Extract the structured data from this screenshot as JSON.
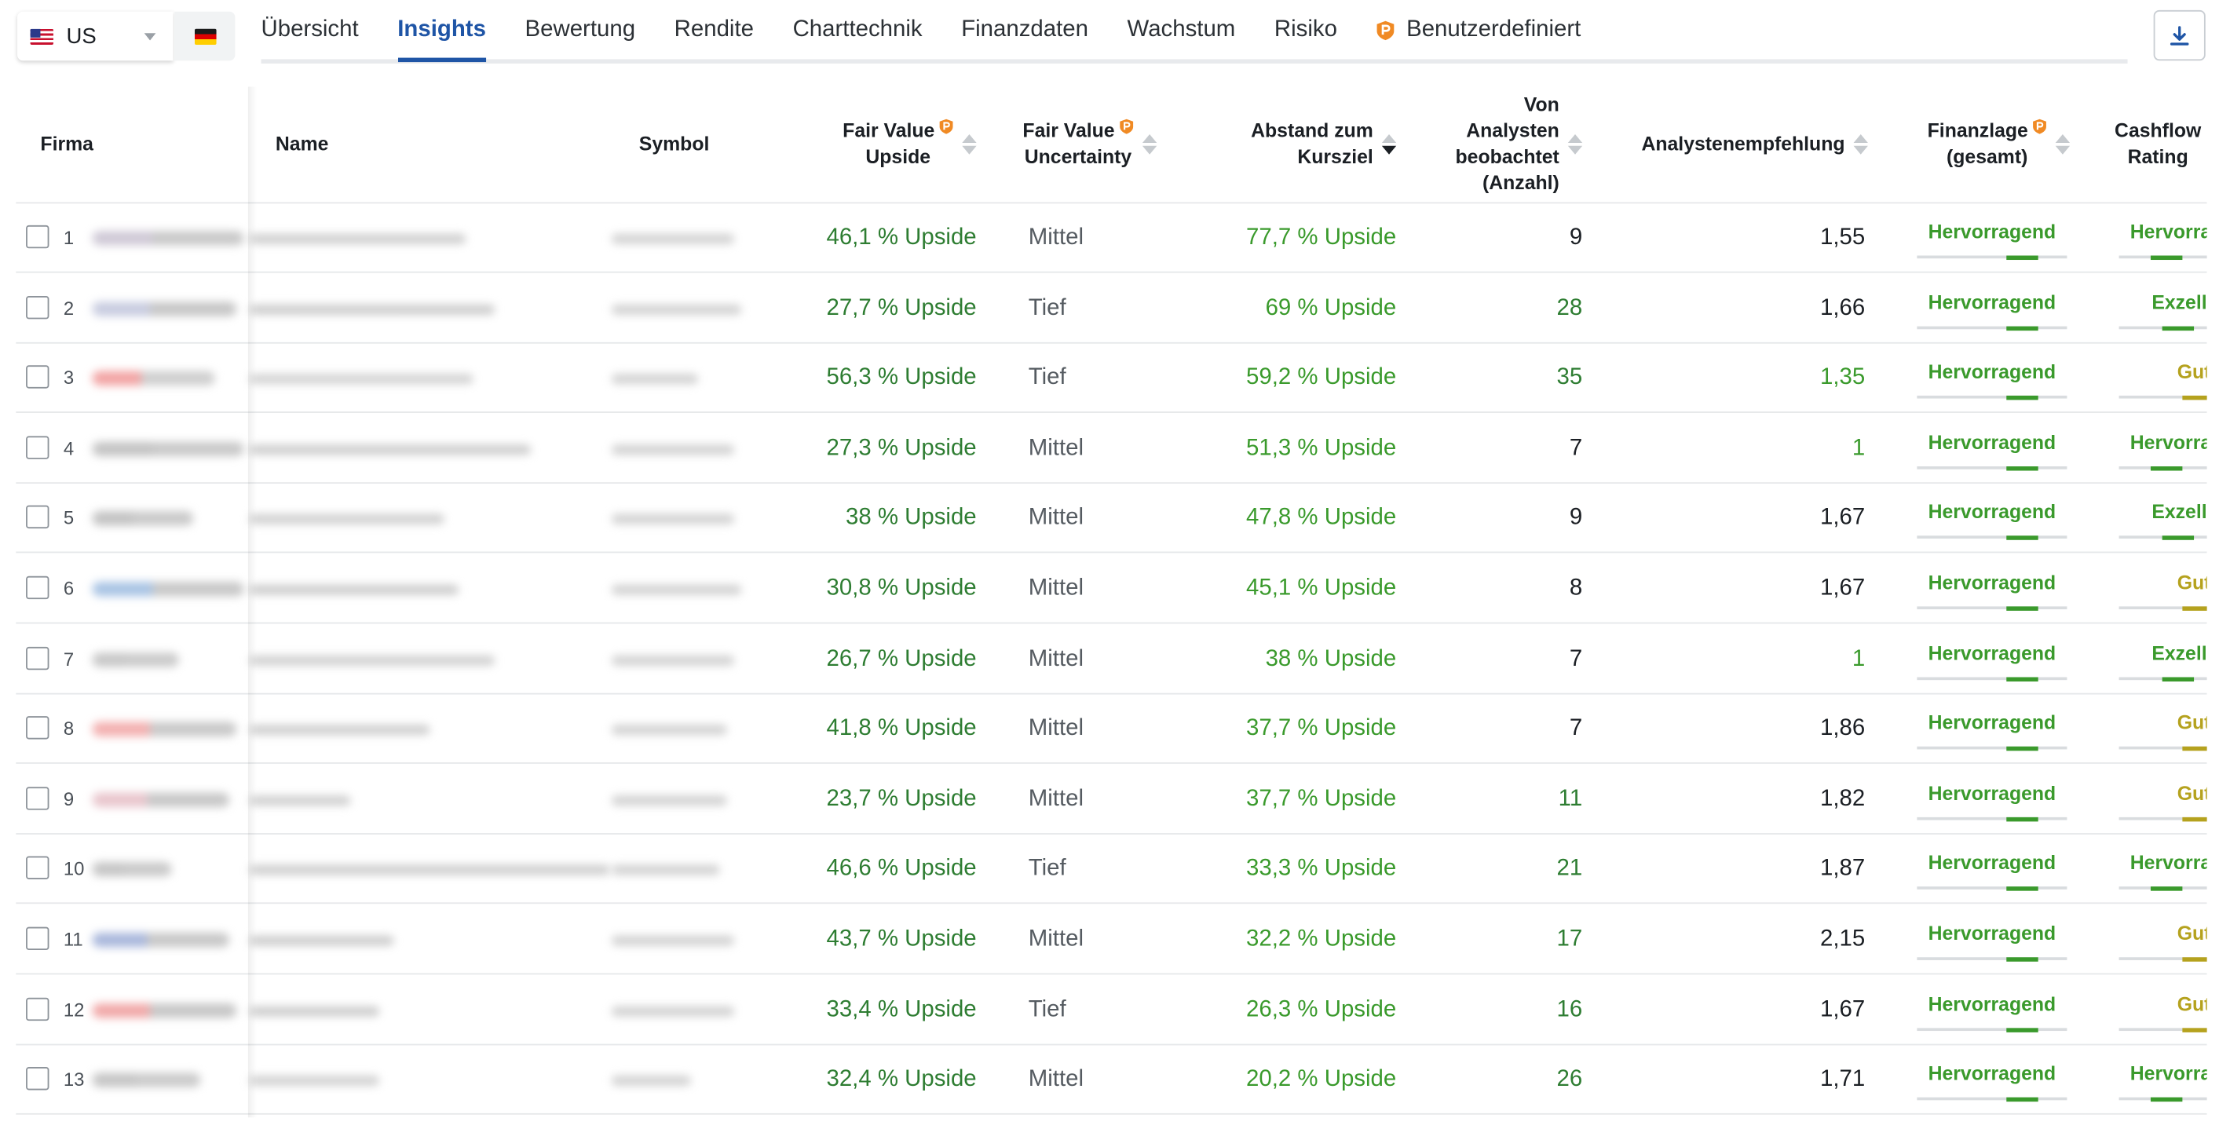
{
  "market": {
    "label": "US"
  },
  "tabs": [
    {
      "label": "Übersicht",
      "active": false,
      "pro": false
    },
    {
      "label": "Insights",
      "active": true,
      "pro": false
    },
    {
      "label": "Bewertung",
      "active": false,
      "pro": false
    },
    {
      "label": "Rendite",
      "active": false,
      "pro": false
    },
    {
      "label": "Charttechnik",
      "active": false,
      "pro": false
    },
    {
      "label": "Finanzdaten",
      "active": false,
      "pro": false
    },
    {
      "label": "Wachstum",
      "active": false,
      "pro": false
    },
    {
      "label": "Risiko",
      "active": false,
      "pro": false
    },
    {
      "label": "Benutzerdefiniert",
      "active": false,
      "pro": true
    }
  ],
  "columns": {
    "firma": "Firma",
    "name": "Name",
    "symbol": "Symbol",
    "fv_upside": [
      "Fair Value",
      "Upside"
    ],
    "fv_uncertainty": [
      "Fair Value",
      "Uncertainty"
    ],
    "abstand": [
      "Abstand zum",
      "Kursziel"
    ],
    "analysten": [
      "Von",
      "Analysten",
      "beobachtet",
      "(Anzahl)"
    ],
    "empfehlung": "Analystenempfehlung",
    "finanzlage": [
      "Finanzlage",
      "(gesamt)"
    ],
    "cashflow": [
      "Cashflow",
      "Rating"
    ]
  },
  "colors": {
    "accent": "#1f55a6",
    "pro_orange": "#f08a24",
    "green_dark": "#2e7d32",
    "green_light": "#3a9a2c",
    "rating_gold": "#b5a21e"
  },
  "rows": [
    {
      "rank": "1",
      "fv_upside": "46,1 % Upside",
      "uncertainty": "Mittel",
      "abstand": "77,7 % Upside",
      "analysten": "9",
      "empfehlung": "1,55",
      "finanzlage": "Hervorragend",
      "cashflow": "Hervorragend"
    },
    {
      "rank": "2",
      "fv_upside": "27,7 % Upside",
      "uncertainty": "Tief",
      "abstand": "69 % Upside",
      "analysten": "28",
      "empfehlung": "1,66",
      "finanzlage": "Hervorragend",
      "cashflow": "Exzellent"
    },
    {
      "rank": "3",
      "fv_upside": "56,3 % Upside",
      "uncertainty": "Tief",
      "abstand": "59,2 % Upside",
      "analysten": "35",
      "empfehlung": "1,35",
      "finanzlage": "Hervorragend",
      "cashflow": "Gut"
    },
    {
      "rank": "4",
      "fv_upside": "27,3 % Upside",
      "uncertainty": "Mittel",
      "abstand": "51,3 % Upside",
      "analysten": "7",
      "empfehlung": "1",
      "finanzlage": "Hervorragend",
      "cashflow": "Hervorragend"
    },
    {
      "rank": "5",
      "fv_upside": "38 % Upside",
      "uncertainty": "Mittel",
      "abstand": "47,8 % Upside",
      "analysten": "9",
      "empfehlung": "1,67",
      "finanzlage": "Hervorragend",
      "cashflow": "Exzellent"
    },
    {
      "rank": "6",
      "fv_upside": "30,8 % Upside",
      "uncertainty": "Mittel",
      "abstand": "45,1 % Upside",
      "analysten": "8",
      "empfehlung": "1,67",
      "finanzlage": "Hervorragend",
      "cashflow": "Gut"
    },
    {
      "rank": "7",
      "fv_upside": "26,7 % Upside",
      "uncertainty": "Mittel",
      "abstand": "38 % Upside",
      "analysten": "7",
      "empfehlung": "1",
      "finanzlage": "Hervorragend",
      "cashflow": "Exzellent"
    },
    {
      "rank": "8",
      "fv_upside": "41,8 % Upside",
      "uncertainty": "Mittel",
      "abstand": "37,7 % Upside",
      "analysten": "7",
      "empfehlung": "1,86",
      "finanzlage": "Hervorragend",
      "cashflow": "Gut"
    },
    {
      "rank": "9",
      "fv_upside": "23,7 % Upside",
      "uncertainty": "Mittel",
      "abstand": "37,7 % Upside",
      "analysten": "11",
      "empfehlung": "1,82",
      "finanzlage": "Hervorragend",
      "cashflow": "Gut"
    },
    {
      "rank": "10",
      "fv_upside": "46,6 % Upside",
      "uncertainty": "Tief",
      "abstand": "33,3 % Upside",
      "analysten": "21",
      "empfehlung": "1,87",
      "finanzlage": "Hervorragend",
      "cashflow": "Hervorragend"
    },
    {
      "rank": "11",
      "fv_upside": "43,7 % Upside",
      "uncertainty": "Mittel",
      "abstand": "32,2 % Upside",
      "analysten": "17",
      "empfehlung": "2,15",
      "finanzlage": "Hervorragend",
      "cashflow": "Gut"
    },
    {
      "rank": "12",
      "fv_upside": "33,4 % Upside",
      "uncertainty": "Tief",
      "abstand": "26,3 % Upside",
      "analysten": "16",
      "empfehlung": "1,67",
      "finanzlage": "Hervorragend",
      "cashflow": "Gut"
    },
    {
      "rank": "13",
      "fv_upside": "32,4 % Upside",
      "uncertainty": "Mittel",
      "abstand": "20,2 % Upside",
      "analysten": "26",
      "empfehlung": "1,71",
      "finanzlage": "Hervorragend",
      "cashflow": "Hervorragend"
    }
  ]
}
